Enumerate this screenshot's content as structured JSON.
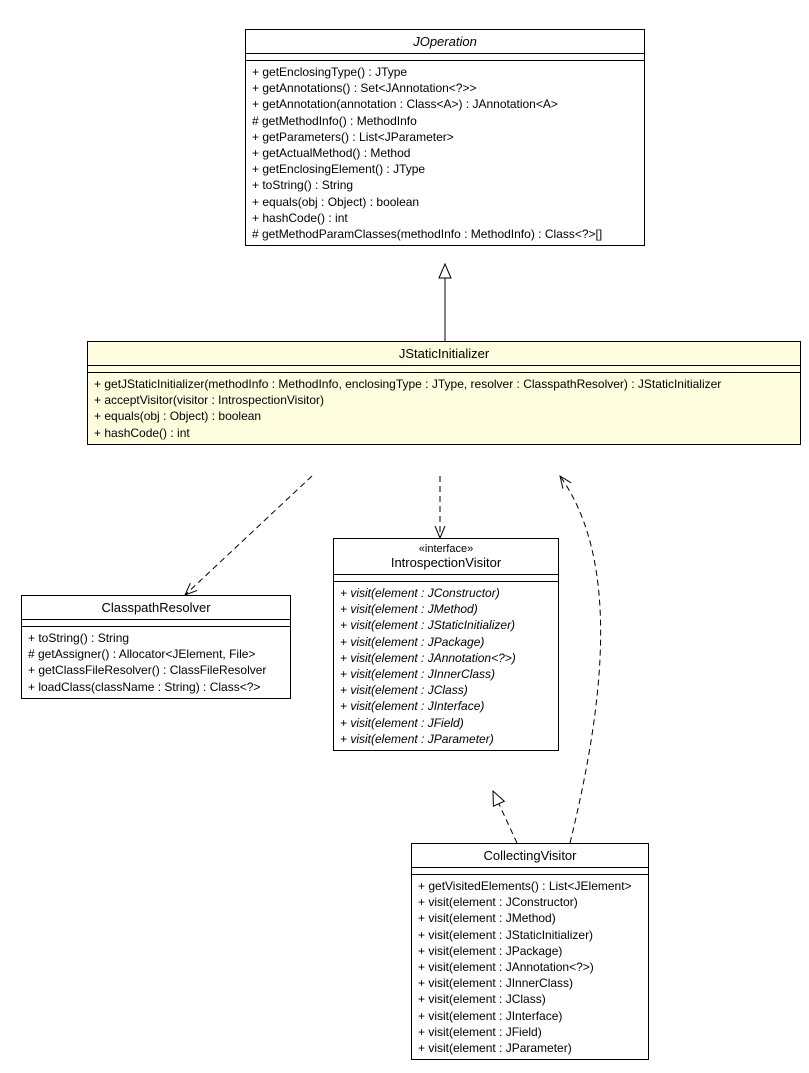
{
  "classes": {
    "joperation": {
      "name": "JOperation",
      "italic": true,
      "ops": [
        "+ getEnclosingType() : JType",
        "+ getAnnotations() : Set<JAnnotation<?>>",
        "+ getAnnotation(annotation : Class<A>) : JAnnotation<A>",
        "# getMethodInfo() : MethodInfo",
        "+ getParameters() : List<JParameter>",
        "+ getActualMethod() : Method",
        "+ getEnclosingElement() : JType",
        "+ toString() : String",
        "+ equals(obj : Object) : boolean",
        "+ hashCode() : int",
        "# getMethodParamClasses(methodInfo : MethodInfo) : Class<?>[]"
      ]
    },
    "jstatic": {
      "name": "JStaticInitializer",
      "ops": [
        "+ getJStaticInitializer(methodInfo : MethodInfo, enclosingType : JType, resolver : ClasspathResolver) : JStaticInitializer",
        "+ acceptVisitor(visitor : IntrospectionVisitor)",
        "+ equals(obj : Object) : boolean",
        "+ hashCode() : int"
      ]
    },
    "classpath": {
      "name": "ClasspathResolver",
      "ops": [
        "+ toString() : String",
        "# getAssigner() : Allocator<JElement, File>",
        "+ getClassFileResolver() : ClassFileResolver",
        "+ loadClass(className : String) : Class<?>"
      ]
    },
    "introspection": {
      "name": "IntrospectionVisitor",
      "stereotype": "«interface»",
      "ops": [
        "+ visit(element : JConstructor)",
        "+ visit(element : JMethod)",
        "+ visit(element : JStaticInitializer)",
        "+ visit(element : JPackage)",
        "+ visit(element : JAnnotation<?>)",
        "+ visit(element : JInnerClass)",
        "+ visit(element : JClass)",
        "+ visit(element : JInterface)",
        "+ visit(element : JField)",
        "+ visit(element : JParameter)"
      ],
      "italic_ops": true
    },
    "collecting": {
      "name": "CollectingVisitor",
      "ops": [
        "+ getVisitedElements() : List<JElement>",
        "+ visit(element : JConstructor)",
        "+ visit(element : JMethod)",
        "+ visit(element : JStaticInitializer)",
        "+ visit(element : JPackage)",
        "+ visit(element : JAnnotation<?>)",
        "+ visit(element : JInnerClass)",
        "+ visit(element : JClass)",
        "+ visit(element : JInterface)",
        "+ visit(element : JField)",
        "+ visit(element : JParameter)"
      ]
    }
  }
}
